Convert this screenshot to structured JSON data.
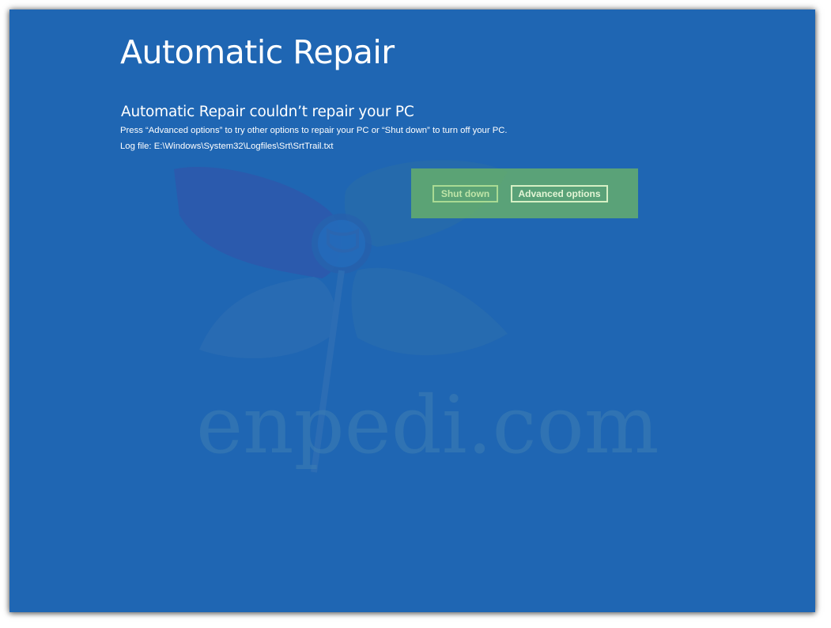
{
  "screen": {
    "title": "Automatic Repair",
    "subtitle": "Automatic Repair couldn’t repair your PC",
    "message": "Press “Advanced options” to try other options to repair your PC or “Shut down” to turn off your PC.",
    "log_file": "Log file: E:\\Windows\\System32\\Logfiles\\Srt\\SrtTrail.txt",
    "background_color": "#1f66b3"
  },
  "buttons": {
    "shut_down": "Shut down",
    "advanced_options": "Advanced options",
    "panel_color": "#76be5c"
  },
  "watermark": {
    "text": "enpedi.com",
    "icon": "clover-logo-icon"
  }
}
